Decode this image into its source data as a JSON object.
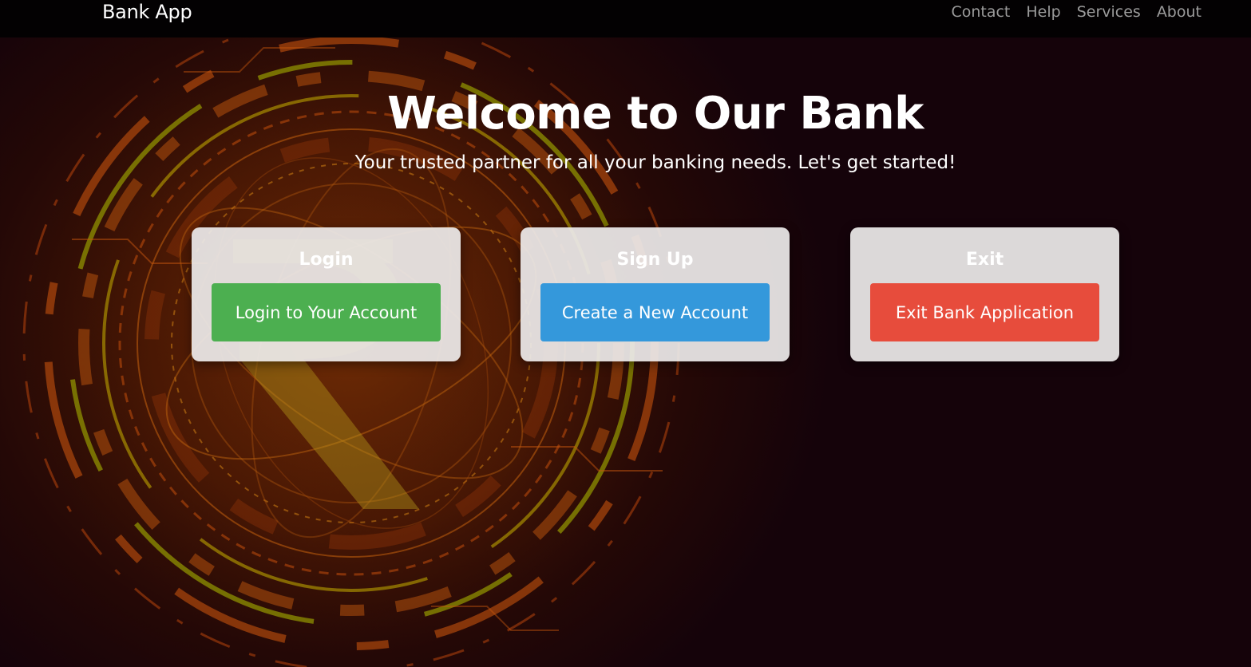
{
  "navbar": {
    "brand": "Bank App",
    "links": [
      "Contact",
      "Help",
      "Services",
      "About"
    ]
  },
  "hero": {
    "title": "Welcome to Our Bank",
    "subtitle": "Your trusted partner for all your banking needs. Let's get started!"
  },
  "cards": [
    {
      "title": "Login",
      "button_label": "Login to Your Account",
      "button_color": "#4caf50"
    },
    {
      "title": "Sign Up",
      "button_label": "Create a New Account",
      "button_color": "#3498db"
    },
    {
      "title": "Exit",
      "button_label": "Exit Bank Application",
      "button_color": "#e74c3c"
    }
  ],
  "background": {
    "icon": "rupee-symbol-circuit-icon",
    "accent_colors": [
      "#c84a0e",
      "#9fb000",
      "#5a2004",
      "#15030a"
    ]
  }
}
